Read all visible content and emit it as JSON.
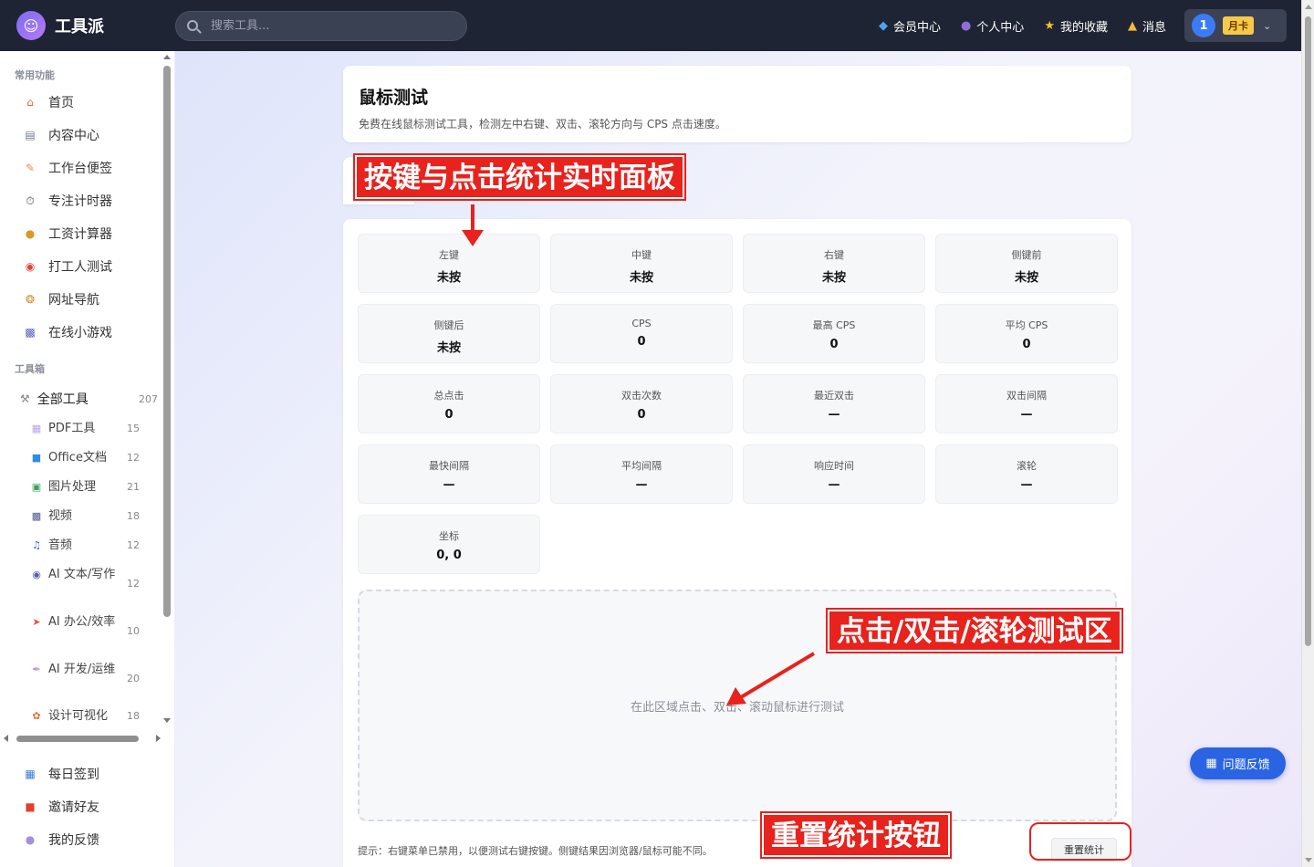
{
  "app": {
    "name": "工具派"
  },
  "search": {
    "placeholder": "搜索工具..."
  },
  "topnav": {
    "items": [
      {
        "icon": "diamond-icon",
        "label": "会员中心"
      },
      {
        "icon": "user-icon",
        "label": "个人中心"
      },
      {
        "icon": "star-icon",
        "label": "我的收藏"
      },
      {
        "icon": "bell-icon",
        "label": "消息"
      }
    ],
    "user": {
      "avatar_text": "1",
      "badge": "月卡"
    }
  },
  "sidebar": {
    "section_common": "常用功能",
    "common_items": [
      {
        "icon": "home-icon",
        "label": "首页"
      },
      {
        "icon": "content-icon",
        "label": "内容中心"
      },
      {
        "icon": "memo-icon",
        "label": "工作台便签"
      },
      {
        "icon": "timer-icon",
        "label": "专注计时器"
      },
      {
        "icon": "money-bag-icon",
        "label": "工资计算器"
      },
      {
        "icon": "target-icon",
        "label": "打工人测试"
      },
      {
        "icon": "compass-icon",
        "label": "网址导航"
      },
      {
        "icon": "gamepad-icon",
        "label": "在线小游戏"
      }
    ],
    "section_tools": "工具箱",
    "all_tools": {
      "icon": "tools-icon",
      "label": "全部工具",
      "count": "207"
    },
    "tool_items": [
      {
        "icon": "pdf-icon",
        "label": "PDF工具",
        "count": "15"
      },
      {
        "icon": "office-icon",
        "label": "Office文档",
        "count": "12"
      },
      {
        "icon": "image-icon",
        "label": "图片处理",
        "count": "21"
      },
      {
        "icon": "video-icon",
        "label": "视频",
        "count": "18"
      },
      {
        "icon": "music-icon",
        "label": "音频",
        "count": "12"
      },
      {
        "icon": "robot-icon",
        "label": "AI 文本/写作",
        "count": "12"
      },
      {
        "icon": "rocket-icon",
        "label": "AI 办公/效率",
        "count": "10"
      },
      {
        "icon": "wrench-icon",
        "label": "AI 开发/运维",
        "count": "20"
      },
      {
        "icon": "palette-icon",
        "label": "设计可视化",
        "count": "18"
      }
    ],
    "bottom_items": [
      {
        "icon": "calendar-icon",
        "label": "每日签到"
      },
      {
        "icon": "gift-icon",
        "label": "邀请好友"
      },
      {
        "icon": "chat-icon",
        "label": "我的反馈"
      }
    ]
  },
  "page": {
    "title": "鼠标测试",
    "description": "免费在线鼠标测试工具，检测左中右键、双击、滚轮方向与 CPS 点击速度。"
  },
  "stats": [
    {
      "label": "左键",
      "value": "未按"
    },
    {
      "label": "中键",
      "value": "未按"
    },
    {
      "label": "右键",
      "value": "未按"
    },
    {
      "label": "侧键前",
      "value": "未按"
    },
    {
      "label": "侧键后",
      "value": "未按"
    },
    {
      "label": "CPS",
      "value": "0"
    },
    {
      "label": "最高 CPS",
      "value": "0"
    },
    {
      "label": "平均 CPS",
      "value": "0"
    },
    {
      "label": "总点击",
      "value": "0"
    },
    {
      "label": "双击次数",
      "value": "0"
    },
    {
      "label": "最近双击",
      "value": "—"
    },
    {
      "label": "双击间隔",
      "value": "—"
    },
    {
      "label": "最快间隔",
      "value": "—"
    },
    {
      "label": "平均间隔",
      "value": "—"
    },
    {
      "label": "响应时间",
      "value": "—"
    },
    {
      "label": "滚轮",
      "value": "—"
    },
    {
      "label": "坐标",
      "value": "0, 0"
    }
  ],
  "test_zone": {
    "text": "在此区域点击、双击、滚动鼠标进行测试"
  },
  "hint": "提示：右键菜单已禁用，以便测试右键按键。侧键结果因浏览器/鼠标可能不同。",
  "reset_label": "重置统计",
  "feedback_label": "问题反馈",
  "annotations": {
    "stats_panel": "按键与点击统计实时面板",
    "test_area": "点击/双击/滚轮测试区",
    "reset_button": "重置统计按钮"
  },
  "colors": {
    "accent": "#2b64e3",
    "topbar": "#1e2433",
    "annotation": "#e8221c"
  }
}
